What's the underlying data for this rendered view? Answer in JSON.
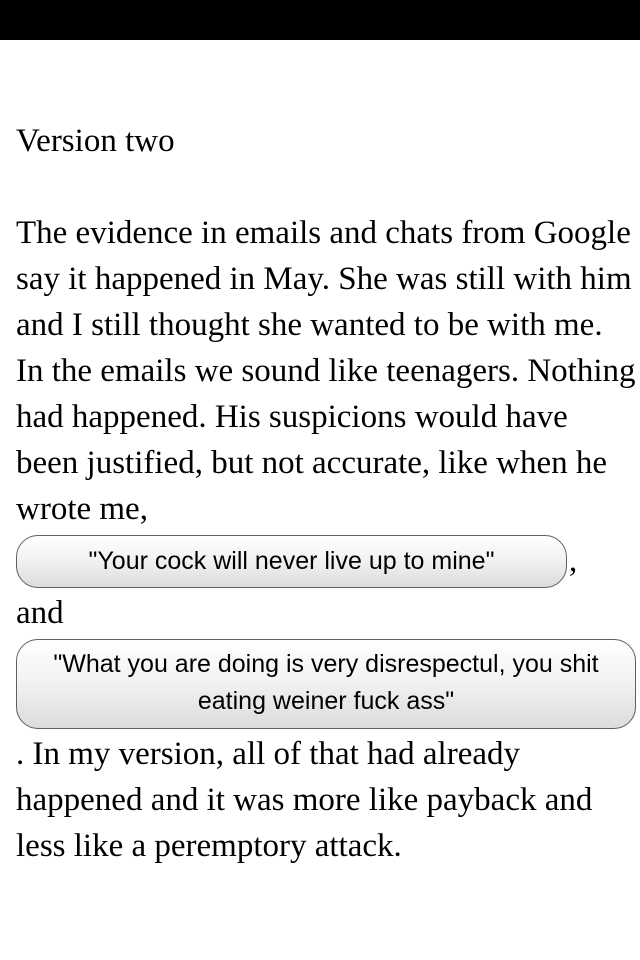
{
  "title": "Version two",
  "paragraph": {
    "intro": "The evidence in emails and chats from Google say it happened in May. She was still with him and I still thought she wanted to be with me. In the emails we sound like teenagers. Nothing had happened. His suspicions would have been justified, but not accurate, like when he wrote me,",
    "quote1": "\"Your cock will never live up to mine\"",
    "after_quote1": ",",
    "conjunction": "and",
    "quote2": "\"What you are doing is very disrespectul, you shit eating weiner fuck ass\"",
    "outro": ". In my version, all of that had already happened and it was more like payback and less like a peremptory attack."
  }
}
